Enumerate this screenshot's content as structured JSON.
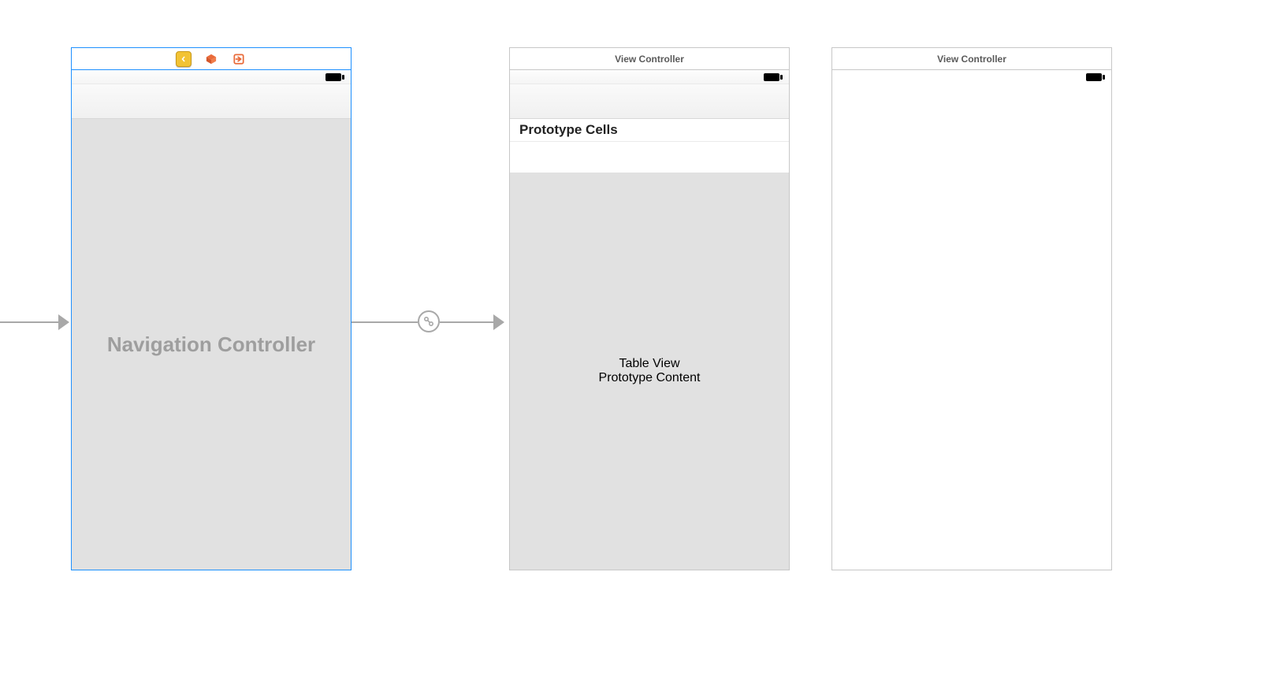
{
  "scenes": {
    "nav": {
      "placeholder_label": "Navigation Controller",
      "selected": true,
      "dock_icons": {
        "back_shield": "shield-chevron-left-icon",
        "first_responder": "first-responder-cube-icon",
        "exit": "exit-icon"
      }
    },
    "table": {
      "dock_title": "View Controller",
      "prototype_header": "Prototype Cells",
      "placeholder_label": "Table View",
      "placeholder_sublabel": "Prototype Content"
    },
    "plain": {
      "dock_title": "View Controller"
    }
  },
  "segues": {
    "entry_point_target": "nav",
    "root_relationship_from": "nav",
    "root_relationship_to": "table"
  },
  "colors": {
    "selection_blue": "#1e90ff",
    "canvas_gray_body": "#e1e1e1",
    "placeholder_text": "#9e9e9e",
    "icon_yellow": "#f2c335",
    "icon_orange": "#E96B3A"
  }
}
